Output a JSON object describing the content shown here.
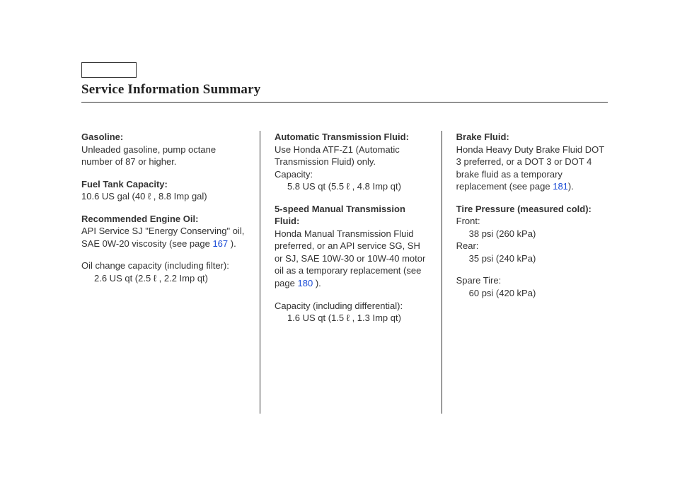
{
  "title": "Service Information Summary",
  "col1": {
    "gasoline_label": "Gasoline:",
    "gasoline_body": "Unleaded gasoline, pump octane number of 87 or higher.",
    "fuel_tank_label": "Fuel Tank Capacity:",
    "fuel_tank_body": "10.6 US gal (40 ℓ , 8.8 Imp gal)",
    "oil_label": "Recommended Engine Oil:",
    "oil_body_a": "API Service SJ \"Energy Conserving\" oil, SAE 0W-20 viscosity (see page ",
    "oil_link": "167",
    "oil_body_b": " ).",
    "oil_change_a": "Oil change capacity (including filter):",
    "oil_change_b": "2.6 US qt (2.5 ℓ , 2.2 Imp qt)"
  },
  "col2": {
    "atf_label": "Automatic Transmission Fluid:",
    "atf_body_a": "Use Honda ATF-Z1 (Automatic Transmission Fluid) only.",
    "atf_body_b": "Capacity:",
    "atf_body_c": "5.8 US qt (5.5 ℓ , 4.8 Imp qt)",
    "mt_label": "5-speed Manual Transmission Fluid:",
    "mt_body_a": "Honda Manual Transmission Fluid preferred, or an API service SG, SH or SJ, SAE 10W-30 or 10W-40 motor oil as a temporary replacement (see page ",
    "mt_link": "180",
    "mt_body_b": " ).",
    "mt_cap_a": "Capacity (including differential):",
    "mt_cap_b": "1.6 US qt (1.5 ℓ , 1.3 Imp qt)"
  },
  "col3": {
    "brake_label": "Brake Fluid:",
    "brake_body_a": "Honda Heavy Duty Brake Fluid DOT 3 preferred, or a DOT 3 or DOT 4 brake fluid as a temporary replacement (see page ",
    "brake_link": "181",
    "brake_body_b": ").",
    "tire_label": "Tire Pressure (measured cold):",
    "front_a": "Front:",
    "front_b": "38 psi (260 kPa)",
    "rear_a": "Rear:",
    "rear_b": "35 psi (240 kPa)",
    "spare_a": "Spare Tire:",
    "spare_b": "60 psi (420 kPa)"
  }
}
